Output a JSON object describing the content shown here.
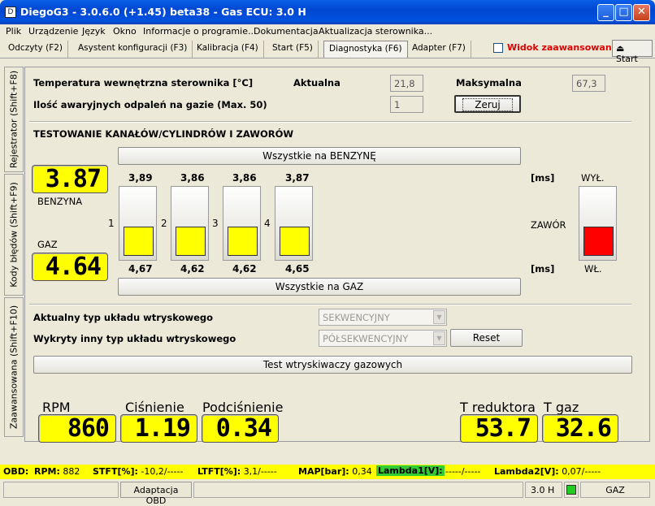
{
  "window": {
    "title": "DiegoG3 - 3.0.6.0 (+1.45) beta38 - Gas ECU: 3.0 H",
    "icon": "D"
  },
  "menu": [
    "Plik",
    "Urządzenie",
    "Język",
    "Okno",
    "Informacje o programie...",
    "Dokumentacja",
    "Aktualizacja sterownika..."
  ],
  "tabs": [
    "Odczyty (F2)",
    "Asystent konfiguracji (F3)",
    "Kalibracja (F4)",
    "Start (F5)",
    "Diagnostyka (F6)",
    "Adapter (F7)"
  ],
  "advanced_view": {
    "label": "Widok zaawansowany",
    "checked": false
  },
  "start_button": "Start",
  "side_tabs": [
    "Rejestrator (Shift+F8)",
    "Kody błędów (Shift+F9)",
    "Zaawansowana (Shift+F10)"
  ],
  "temp": {
    "label": "Temperatura wewnętrzna sterownika [°C]",
    "current_label": "Aktualna",
    "current": "21,8",
    "max_label": "Maksymalna",
    "max": "67,3"
  },
  "misfire": {
    "label": "Ilość awaryjnych odpaleń na gazie (Max. 50)",
    "value": "1",
    "reset": "Zeruj"
  },
  "test": {
    "heading": "TESTOWANIE KANAŁÓW/CYLINDRÓW I ZAWORÓW",
    "all_petrol": "Wszystkie na BENZYNĘ",
    "all_gas": "Wszystkie na GAZ",
    "petrol_label": "BENZYNA",
    "gas_label": "GAZ",
    "petrol_time": "3.87",
    "gas_time": "4.64",
    "ms": "[ms]",
    "cylinders": [
      {
        "n": "1",
        "petrol": "3,89",
        "gas": "4,67"
      },
      {
        "n": "2",
        "petrol": "3,86",
        "gas": "4,62"
      },
      {
        "n": "3",
        "petrol": "3,86",
        "gas": "4,62"
      },
      {
        "n": "4",
        "petrol": "3,87",
        "gas": "4,65"
      }
    ],
    "valve": {
      "label": "ZAWÓR",
      "off": "WYŁ.",
      "on": "WŁ.",
      "state_color": "#ff0000"
    }
  },
  "injection": {
    "current_label": "Aktualny typ układu wtryskowego",
    "current_value": "SEKWENCYJNY",
    "detected_label": "Wykryty inny typ układu wtryskowego",
    "detected_value": "PÓŁSEKWENCYJNY",
    "reset": "Reset",
    "test_button": "Test wtryskiwaczy gazowych"
  },
  "gauges": [
    {
      "label": "RPM",
      "value": "860"
    },
    {
      "label": "Ciśnienie",
      "value": "1.19"
    },
    {
      "label": "Podciśnienie",
      "value": "0.34"
    },
    {
      "label": "T reduktora",
      "value": "53.7"
    },
    {
      "label": "T gaz",
      "value": "32.6"
    }
  ],
  "obd": {
    "prefix": "OBD:",
    "rpm_label": "RPM:",
    "rpm": "882",
    "stft_label": "STFT[%]:",
    "stft": "-10,2/-----",
    "ltft_label": "LTFT[%]:",
    "ltft": "3,1/-----",
    "map_label": "MAP[bar]:",
    "map": "0,34",
    "lambda1_label": "Lambda1[V]:",
    "lambda1": "-----/-----",
    "lambda2_label": "Lambda2[V]:",
    "lambda2": "0,07/-----"
  },
  "status": {
    "adapt_button": "Adaptacja OBD",
    "ecu": "3.0 H",
    "fuel": "GAZ",
    "indicator_color": "#22cc22"
  }
}
